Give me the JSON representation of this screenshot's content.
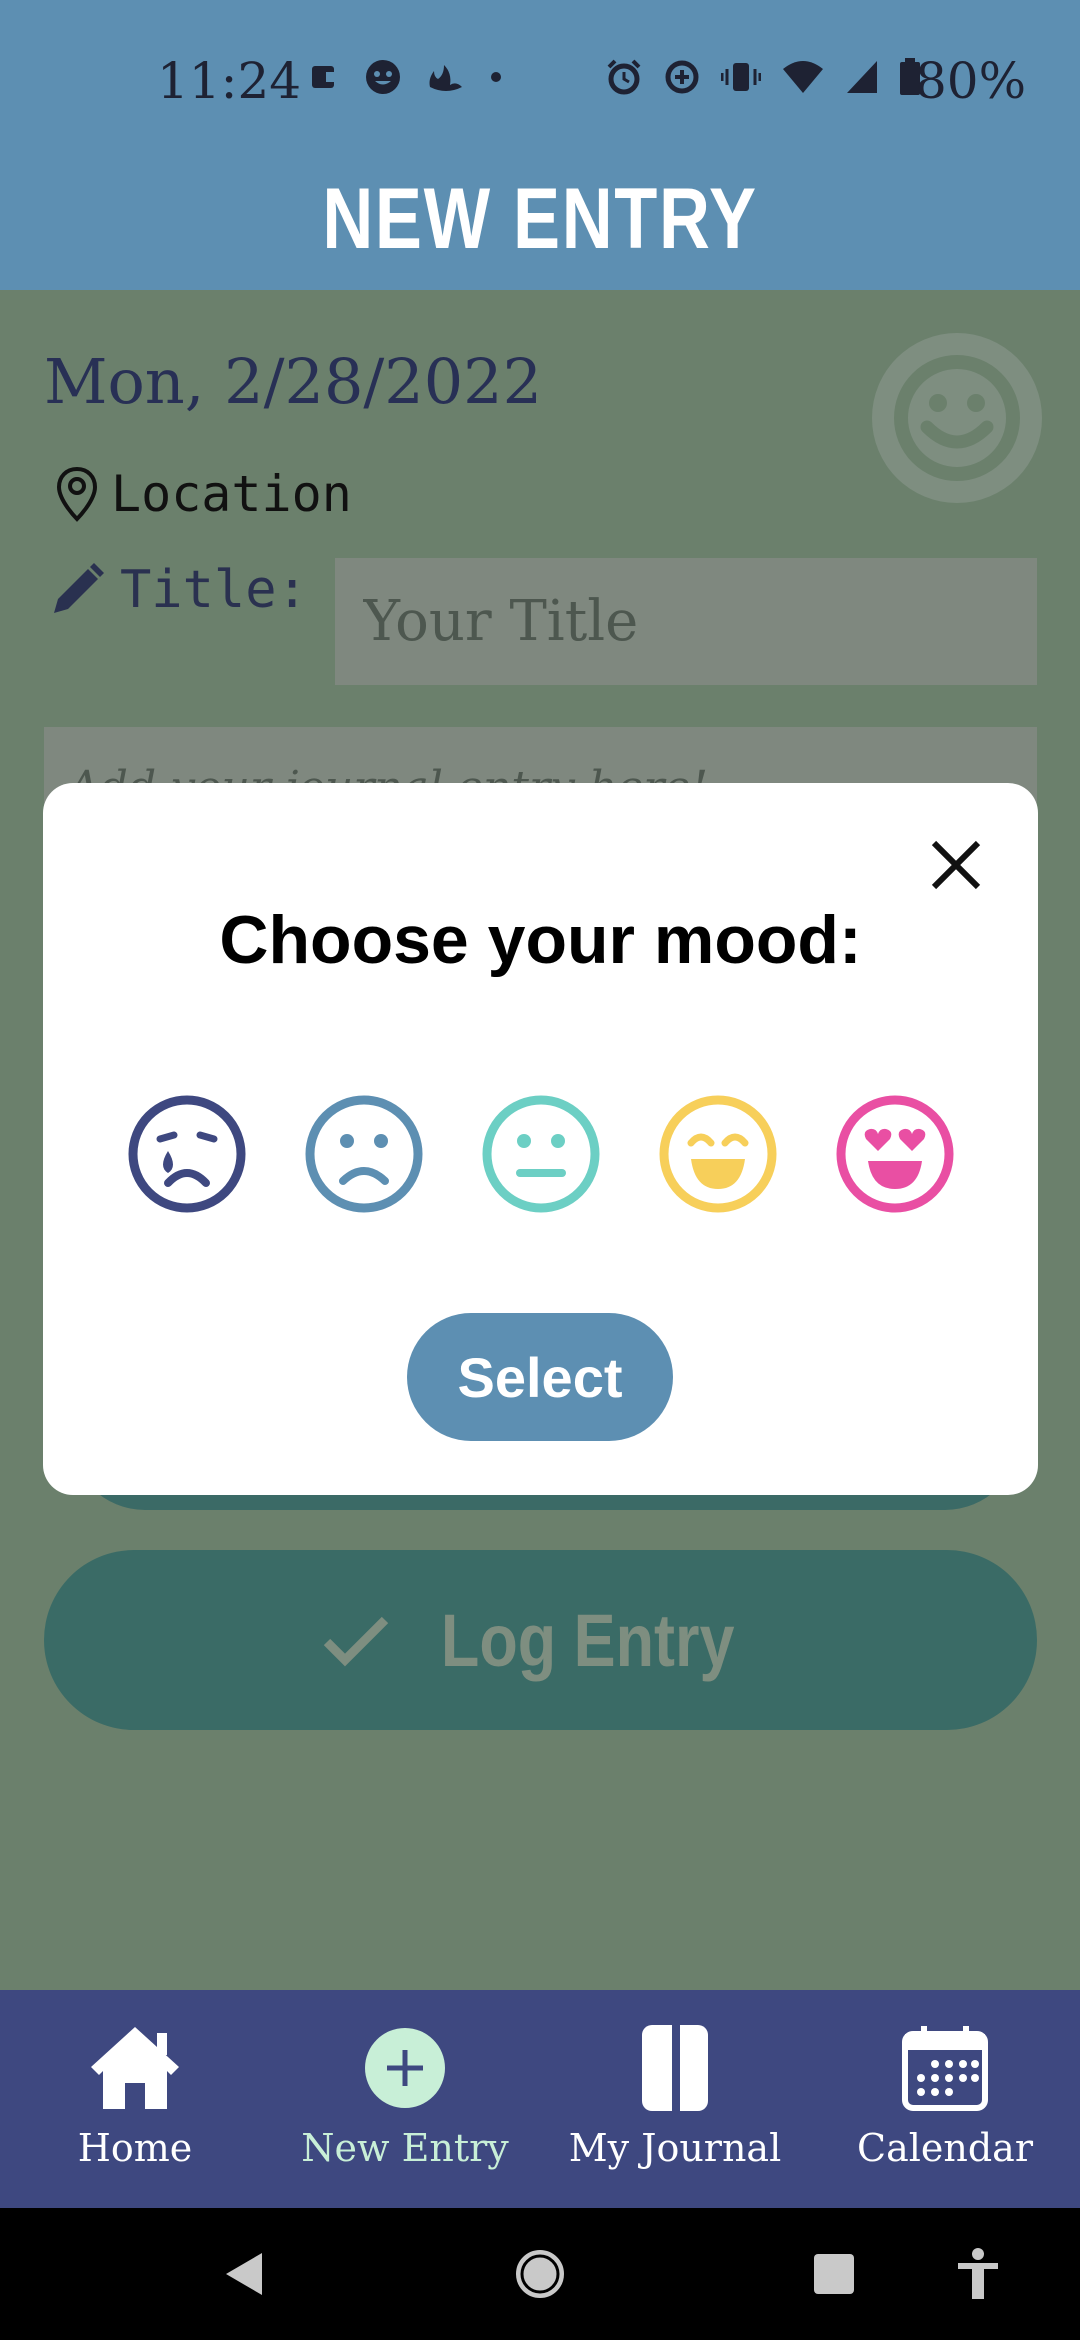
{
  "status_bar": {
    "time": "11:24",
    "battery": "80%"
  },
  "header": {
    "title": "NEW ENTRY"
  },
  "form": {
    "date": "Mon, 2/28/2022",
    "location_label": "Location",
    "title_label": "Title:",
    "title_placeholder": "Your Title",
    "journal_placeholder": "Add your journal entry here!",
    "log_entry_label": "Log Entry"
  },
  "modal": {
    "title": "Choose your mood:",
    "select_label": "Select",
    "moods": [
      {
        "icon": "crying-face-icon",
        "color": "#3e4880"
      },
      {
        "icon": "sad-face-icon",
        "color": "#5d8fb2"
      },
      {
        "icon": "neutral-face-icon",
        "color": "#6ccfc4"
      },
      {
        "icon": "smiling-face-icon",
        "color": "#f7cf5a"
      },
      {
        "icon": "heart-eyes-face-icon",
        "color": "#e94fa3"
      }
    ]
  },
  "bottom_nav": {
    "items": [
      {
        "label": "Home",
        "icon": "home-icon"
      },
      {
        "label": "New Entry",
        "icon": "plus-circle-icon",
        "active": true
      },
      {
        "label": "My Journal",
        "icon": "journal-icon"
      },
      {
        "label": "Calendar",
        "icon": "calendar-icon"
      }
    ]
  },
  "colors": {
    "header": "#5d8fb2",
    "nav": "#3e4880",
    "active_accent": "#c8efd7"
  }
}
